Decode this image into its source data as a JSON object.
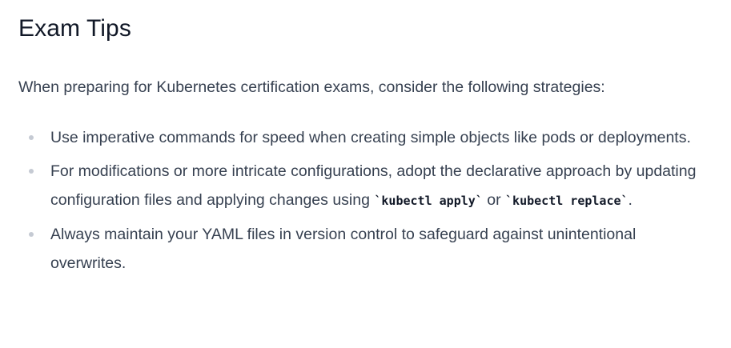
{
  "heading": "Exam Tips",
  "intro": "When preparing for Kubernetes certification exams, consider the following strategies:",
  "tips": [
    {
      "text": "Use imperative commands for speed when creating simple objects like pods or deployments."
    },
    {
      "text_before": "For modifications or more intricate configurations, adopt the declarative approach by updating configuration files and applying changes using ",
      "code1": "`kubectl apply`",
      "text_middle": " or ",
      "code2": "`kubectl replace`",
      "text_after": "."
    },
    {
      "text": "Always maintain your YAML files in version control to safeguard against unintentional overwrites."
    }
  ]
}
